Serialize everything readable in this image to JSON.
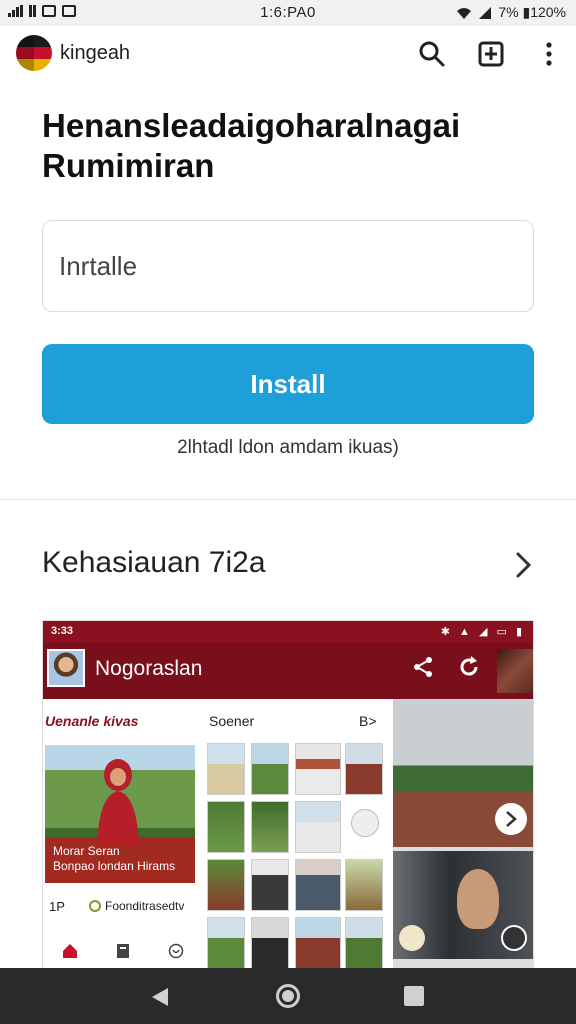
{
  "status_bar": {
    "time": "1:6:PA0",
    "battery_text": "7% ▮120%"
  },
  "app_bar": {
    "app_name": "kingeah",
    "icons": [
      "search-icon",
      "download-icon",
      "more-vert-icon"
    ]
  },
  "headline": {
    "line1": "Henansleadaigoharalnagai",
    "line2": "Rumimiran"
  },
  "input": {
    "placeholder": "Inrtalle"
  },
  "install_button": {
    "label": "Install"
  },
  "install_caption": "2lhtadl ldon amdam ikuas)",
  "section": {
    "title": "Kehasiauan 7i2a"
  },
  "preview": {
    "status_time": "3:33",
    "app_title": "Nogoraslan",
    "left_label": "Uenanle kivas",
    "band_line1": "Morar Seran",
    "band_line2": "Bonpao londan Hirams",
    "meta_count": "1P",
    "meta_text": "Foonditrasedtv",
    "mid_label": "Soener",
    "mid_label2": "B>"
  },
  "colors": {
    "accent": "#1f9fd8",
    "preview_brand": "#7a0f1c"
  }
}
